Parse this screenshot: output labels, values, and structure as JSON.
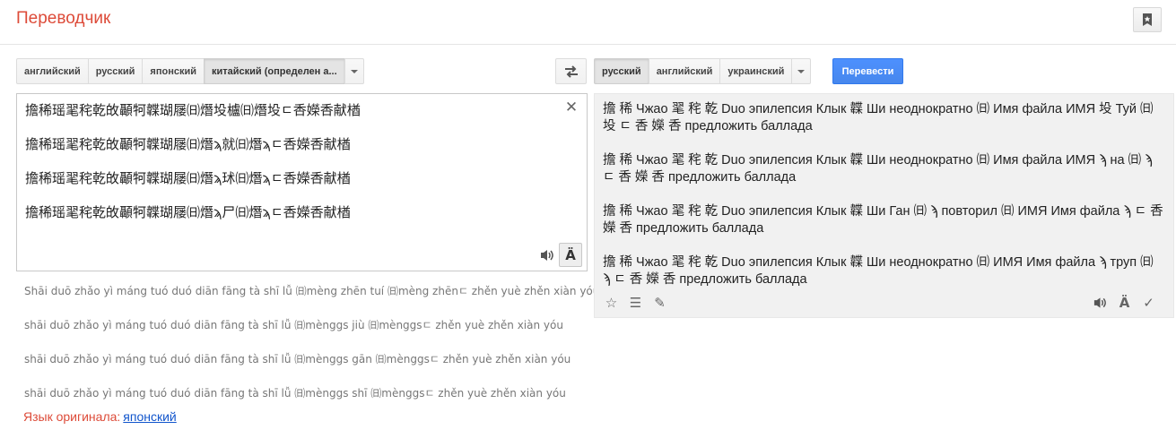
{
  "app": {
    "title": "Переводчик"
  },
  "source_langs": {
    "buttons": [
      "английский",
      "русский",
      "японский",
      "китайский (определен а..."
    ],
    "selected_index": 3
  },
  "target_langs": {
    "buttons": [
      "русский",
      "английский",
      "украинский"
    ],
    "selected_index": 0
  },
  "translate_button": "Перевести",
  "source": {
    "lines": [
      "擔稀瑶毣秺乾敀顳牱韘瑚屦㈰熸坄櫨㈰熸坄ㄷ㕿嬫㕿献楢",
      "擔稀瑶毣秺乾敀顳牱韘瑚屦㈰熸ϡ就㈰熸ϡㄷ㕿嬫㕿献楢",
      "擔稀瑶毣秺乾敀顳牱韘瑚屦㈰熸ϡ㺷㈰熸ϡㄷ㕿嬫㕿献楢",
      "擔稀瑶毣秺乾敀顳牱韘瑚屦㈰熸ϡ尸㈰熸ϡㄷ㕿嬫㕿献楢"
    ],
    "clear_glyph": "✕",
    "keyboard_glyph": "Ä"
  },
  "transliteration": [
    "Shāi duō zhǎo yì máng tuó duó diān fāng tà shī lǚ ㈰mèng zhēn tuí ㈰mèng zhēnㄷ zhěn yuè zhěn xiàn yóu",
    "shāi duō zhǎo yì máng tuó duó diān fāng tà shī lǚ ㈰mènggs jiù ㈰mènggsㄷ zhěn yuè zhěn xiàn yóu",
    "shāi duō zhǎo yì máng tuó duó diān fāng tà shī lǚ ㈰mènggs gān ㈰mènggsㄷ zhěn yuè zhěn xiàn yóu",
    "shāi duō zhǎo yì máng tuó duó diān fāng tà shī lǚ ㈰mènggs shī ㈰mènggsㄷ zhěn yuè zhěn xiàn yóu"
  ],
  "detected": {
    "label": "Язык оригинала:",
    "language": "японский"
  },
  "result": {
    "paragraphs": [
      "擔 稀 Чжао 毣 秺 乾 Duo эпилепсия Клык 韘 Ши неоднократно ㈰ Имя файла ИМЯ 坄 Туй ㈰ 坄 ㄷ 㕿 嬫 㕿 предложить баллада",
      "擔 稀 Чжао 毣 秺 乾 Duo эпилепсия Клык 韘 Ши неоднократно ㈰ Имя файла ИМЯ ϡ на ㈰ ϡ ㄷ 㕿 嬫 㕿 предложить баллада",
      "擔 稀 Чжао 毣 秺 乾 Duo эпилепсия Клык 韘 Ши Ган ㈰ ϡ повторил ㈰ ИМЯ Имя файла ϡ ㄷ 㕿 嬫 㕿 предложить баллада",
      "擔 稀 Чжао 毣 秺 乾 Duo эпилепсия Клык 韘 Ши неоднократно ㈰ ИМЯ Имя файла ϡ труп ㈰ ϡ ㄷ 㕿 嬫 㕿 предложить баллада"
    ],
    "tool_glyphs": {
      "star": "☆",
      "list": "☰",
      "edit": "✎",
      "keyboard": "Ä",
      "check": "✓"
    }
  },
  "colors": {
    "brand": "#dd4b39",
    "blue_button": "#4d90fe",
    "link": "#1155cc",
    "result_bg": "#f1f1f1"
  }
}
